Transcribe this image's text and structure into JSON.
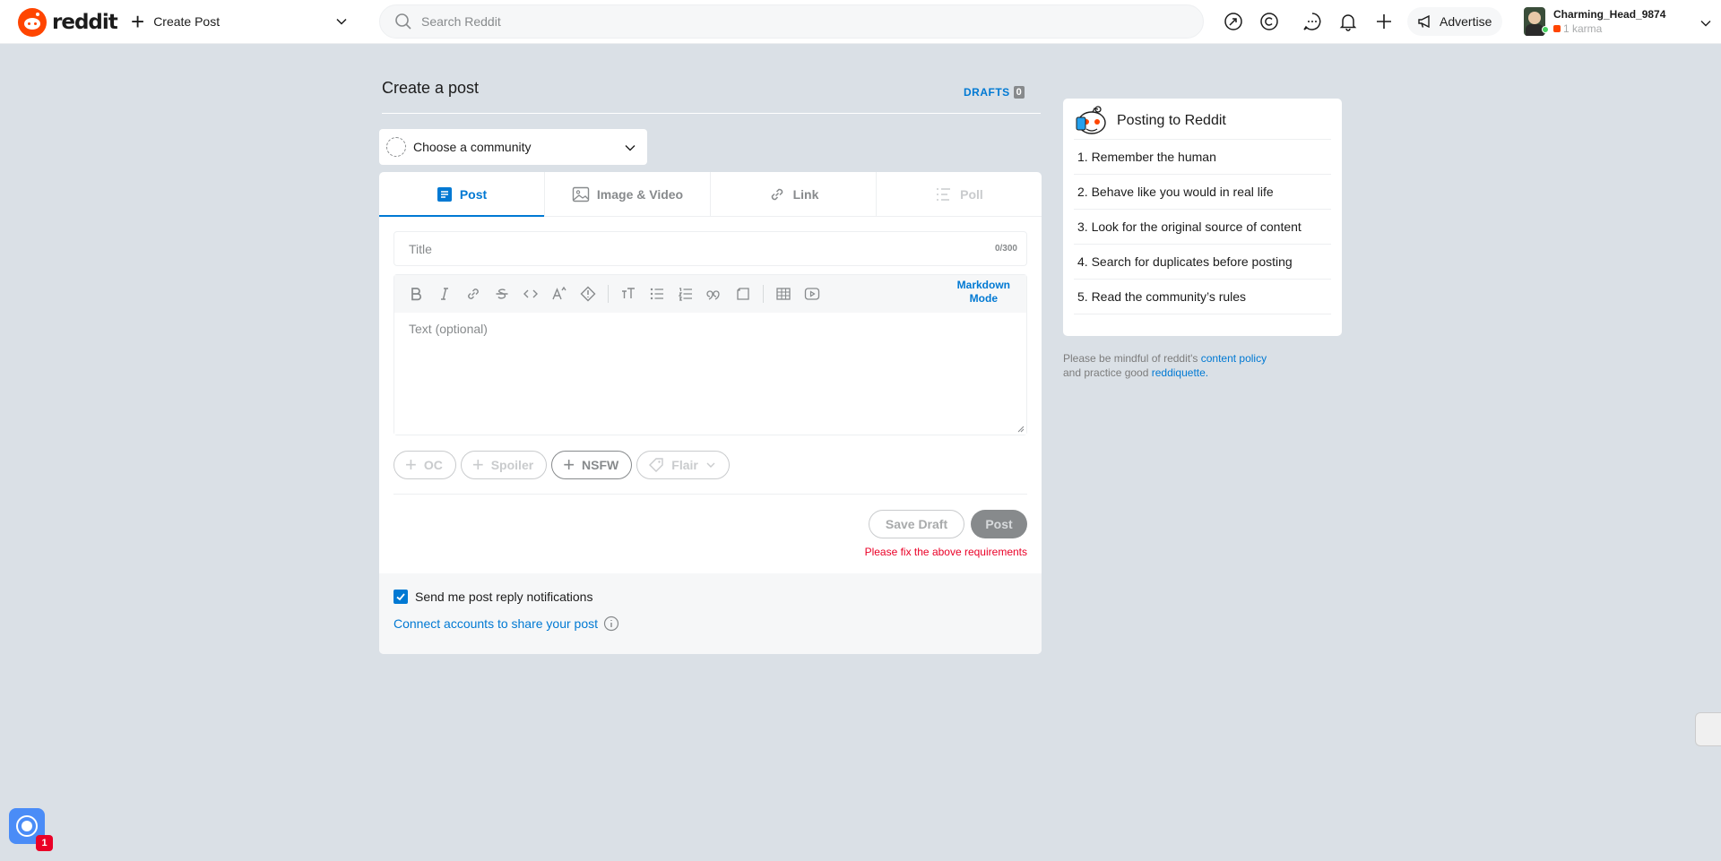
{
  "header": {
    "logo_text": "reddit",
    "home_label": "Create Post",
    "search_placeholder": "Search Reddit",
    "advertise_label": "Advertise",
    "user_name": "Charming_Head_9874",
    "user_karma": "1 karma"
  },
  "main": {
    "page_title": "Create a post",
    "drafts_label": "DRAFTS",
    "drafts_count": "0",
    "community_placeholder": "Choose a community",
    "tabs": [
      {
        "label": "Post",
        "icon": "post-icon",
        "state": "active"
      },
      {
        "label": "Image & Video",
        "icon": "image-icon",
        "state": "normal"
      },
      {
        "label": "Link",
        "icon": "link-icon",
        "state": "normal"
      },
      {
        "label": "Poll",
        "icon": "poll-icon",
        "state": "disabled"
      }
    ],
    "title_placeholder": "Title",
    "title_count": "0/300",
    "markdown_mode_line1": "Markdown",
    "markdown_mode_line2": "Mode",
    "text_placeholder": "Text (optional)",
    "tags": [
      {
        "label": "OC",
        "icon": "plus-icon",
        "state": "disabled"
      },
      {
        "label": "Spoiler",
        "icon": "plus-icon",
        "state": "disabled"
      },
      {
        "label": "NSFW",
        "icon": "plus-icon",
        "state": "active"
      },
      {
        "label": "Flair",
        "icon": "tag-icon",
        "state": "disabled"
      }
    ],
    "save_draft_label": "Save Draft",
    "post_label": "Post",
    "error_text": "Please fix the above requirements",
    "notifications_label": "Send me post reply notifications",
    "notifications_checked": true,
    "connect_label": "Connect accounts to share your post"
  },
  "sidebar": {
    "title": "Posting to Reddit",
    "rules": [
      "1. Remember the human",
      "2. Behave like you would in real life",
      "3. Look for the original source of content",
      "4. Search for duplicates before posting",
      "5. Read the community’s rules"
    ],
    "policy_text_1": "Please be mindful of reddit's",
    "policy_link_1": "content policy",
    "policy_text_2": "and practice good",
    "policy_link_2": "reddiquette."
  },
  "widget": {
    "badge_count": "1"
  },
  "colors": {
    "accent": "#0079d3",
    "brand": "#ff4500",
    "error": "#ea0027",
    "background": "#dae0e6"
  }
}
